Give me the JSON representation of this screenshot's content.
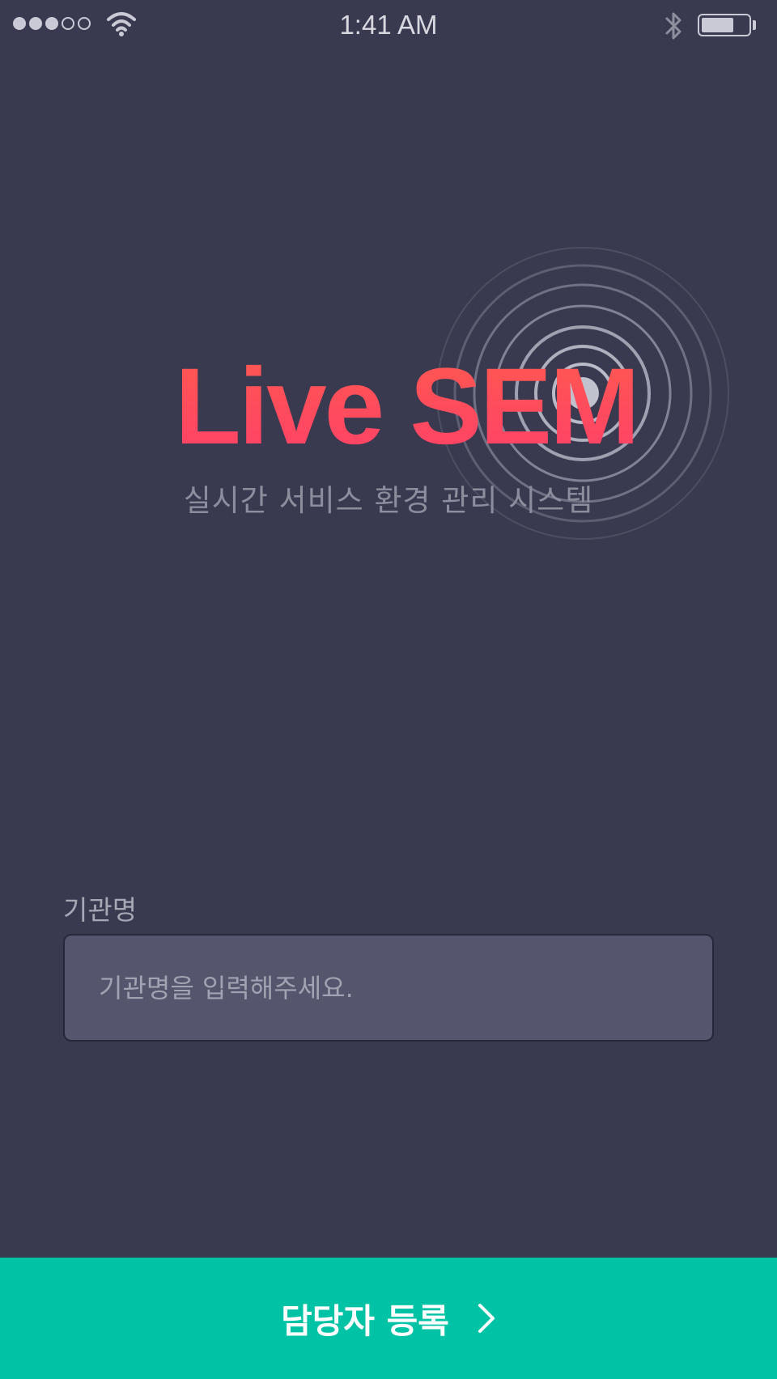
{
  "status_bar": {
    "time": "1:41 AM",
    "signal_dots": {
      "filled": 3,
      "empty": 2
    },
    "battery_level": 0.7,
    "icons": [
      "wifi-icon",
      "bluetooth-icon",
      "battery-icon"
    ]
  },
  "logo": {
    "title": "Live SEM",
    "tagline": "실시간 서비스 환경 관리 시스템",
    "icon": "radar-rings-icon"
  },
  "form": {
    "label": "기관명",
    "placeholder": "기관명을 입력해주세요.",
    "value": ""
  },
  "register_button": {
    "label": "담당자 등록",
    "icon": "chevron-right-icon"
  },
  "colors": {
    "background": "#393a4f",
    "accent": "#00c2a4",
    "logo": "#ff4a5c",
    "input_background": "#55566d"
  }
}
